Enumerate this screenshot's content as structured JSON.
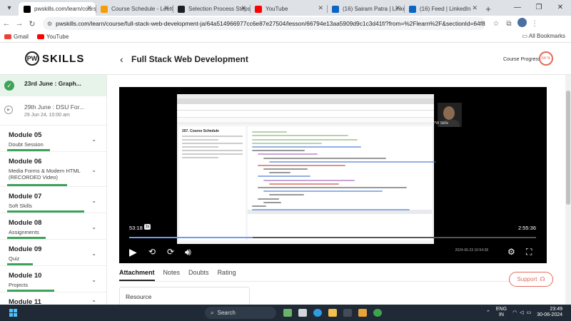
{
  "browser": {
    "tabs": [
      {
        "title": "pwskills.com/learn/course",
        "active": true,
        "favicon_color": "#000000"
      },
      {
        "title": "Course Schedule - LeetCo",
        "active": false,
        "favicon_color": "#f59e0b"
      },
      {
        "title": "Selection Process Steps",
        "active": false,
        "favicon_color": "#1f1f1f"
      },
      {
        "title": "YouTube",
        "active": false,
        "favicon_color": "#ff0000"
      },
      {
        "title": "(16) Sairam Patra | LinkedI",
        "active": false,
        "favicon_color": "#0a66c2"
      },
      {
        "title": "(16) Feed | LinkedIn",
        "active": false,
        "favicon_color": "#0a66c2"
      }
    ],
    "url": "pwskills.com/learn/course/full-stack-web-development-ja/64a514966977cc6e87e27504/lesson/66794e13aa5909d9c1c3d41f/?from=%2Flearn%2F&sectionId=64f86b6cfe327f2c11a60...",
    "bookmarks": [
      {
        "label": "Gmail",
        "color": "#ea4335"
      },
      {
        "label": "YouTube",
        "color": "#ff0000"
      }
    ],
    "all_bookmarks": "All Bookmarks"
  },
  "header": {
    "logo": "SKILLS",
    "course_title": "Full Stack Web Development",
    "progress_label": "Course Progress",
    "progress_value": "64 %",
    "progress_fraction": 0.64
  },
  "sidebar": {
    "completed_lesson": "23rd June : Graph...",
    "next_lesson": {
      "title": "29th June : DSU For...",
      "date": "29 Jun 24, 10:00 am"
    },
    "modules": [
      {
        "title": "Module 05",
        "subtitle": "Doubt Session",
        "progress": 0.5
      },
      {
        "title": "Module 06",
        "subtitle": "Media Forms & Modern HTML (RECORDED Video)",
        "progress": 0.7
      },
      {
        "title": "Module 07",
        "subtitle": "Soft Skills",
        "progress": 0.9
      },
      {
        "title": "Module 08",
        "subtitle": "Assignments",
        "progress": 0.45
      },
      {
        "title": "Module 09",
        "subtitle": "Quiz",
        "progress": 0.3
      },
      {
        "title": "Module 10",
        "subtitle": "Projects",
        "progress": 0.55
      },
      {
        "title": "Module 11",
        "subtitle": "",
        "progress": 0
      }
    ]
  },
  "video": {
    "current_time": "53:18",
    "speed": "1x",
    "duration": "2:55:36",
    "played_fraction": 0.303,
    "recording_timestamp": "2024-06-23  10:54:38",
    "problem_title": "207. Course Schedule",
    "presenter_label": "PW Skills"
  },
  "tabs": [
    "Attachment",
    "Notes",
    "Doubts",
    "Rating"
  ],
  "resource_label": "Resource",
  "support_label": "Support",
  "taskbar": {
    "search_placeholder": "Search",
    "lang_top": "ENG",
    "lang_bottom": "IN",
    "time": "23:49",
    "date": "30-06-2024"
  }
}
